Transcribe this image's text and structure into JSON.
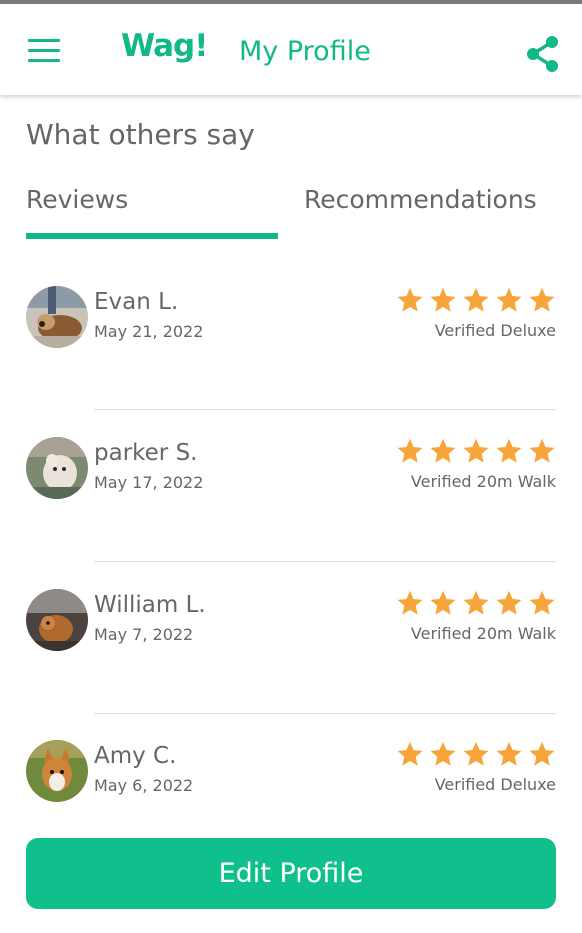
{
  "colors": {
    "brand": "#10b987",
    "star": "#f7a53a",
    "text": "#666666",
    "button": "#10c08c"
  },
  "header": {
    "logo": "Wag!",
    "title": "My Profile",
    "menu_icon": "hamburger-menu-icon",
    "share_icon": "share-icon"
  },
  "section": {
    "title": "What others say"
  },
  "tabs": [
    {
      "label": "Reviews",
      "active": true
    },
    {
      "label": "Recommendations",
      "active": false
    }
  ],
  "reviews": [
    {
      "name": "Evan L.",
      "date": "May 21, 2022",
      "rating": 5,
      "service": "Verified Deluxe"
    },
    {
      "name": "parker S.",
      "date": "May 17, 2022",
      "rating": 5,
      "service": "Verified 20m Walk"
    },
    {
      "name": "William L.",
      "date": "May 7, 2022",
      "rating": 5,
      "service": "Verified 20m Walk"
    },
    {
      "name": "Amy C.",
      "date": "May 6, 2022",
      "rating": 5,
      "service": "Verified Deluxe"
    }
  ],
  "actions": {
    "edit_profile": "Edit Profile"
  }
}
